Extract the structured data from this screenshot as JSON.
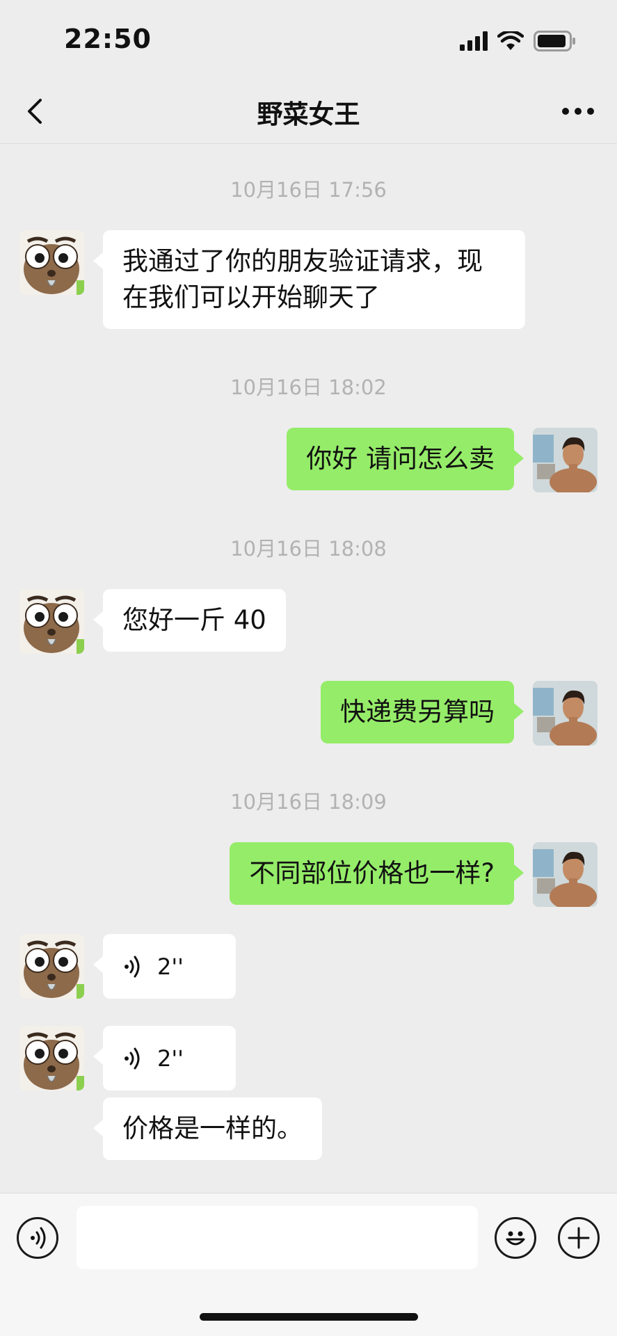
{
  "status_bar": {
    "time": "22:50"
  },
  "header": {
    "title": "野菜女王"
  },
  "chat": {
    "timestamps": [
      "10月16日 17:56",
      "10月16日 18:02",
      "10月16日 18:08",
      "10月16日 18:09"
    ],
    "messages": [
      {
        "from": "contact",
        "type": "text",
        "text": "我通过了你的朋友验证请求，现在我们可以开始聊天了"
      },
      {
        "from": "me",
        "type": "text",
        "text": "你好 请问怎么卖"
      },
      {
        "from": "contact",
        "type": "text",
        "text": "您好一斤 40"
      },
      {
        "from": "me",
        "type": "text",
        "text": "快递费另算吗"
      },
      {
        "from": "me",
        "type": "text",
        "text": "不同部位价格也一样?"
      },
      {
        "from": "contact",
        "type": "voice",
        "duration": "2''"
      },
      {
        "from": "contact",
        "type": "voice",
        "duration": "2''"
      },
      {
        "from": "contact",
        "type": "text",
        "text": "价格是一样的。"
      }
    ]
  },
  "input_bar": {
    "value": ""
  },
  "icons": {
    "back": "chevron-left-icon",
    "more": "more-dots-icon",
    "voice": "voice-wave-icon",
    "emoji": "emoji-icon",
    "add": "plus-icon",
    "signal": "signal-icon",
    "wifi": "wifi-icon",
    "battery": "battery-icon"
  },
  "colors": {
    "background": "#ededed",
    "outgoing_bubble": "#95ec69",
    "incoming_bubble": "#ffffff",
    "timestamp": "#b2b2b2"
  }
}
